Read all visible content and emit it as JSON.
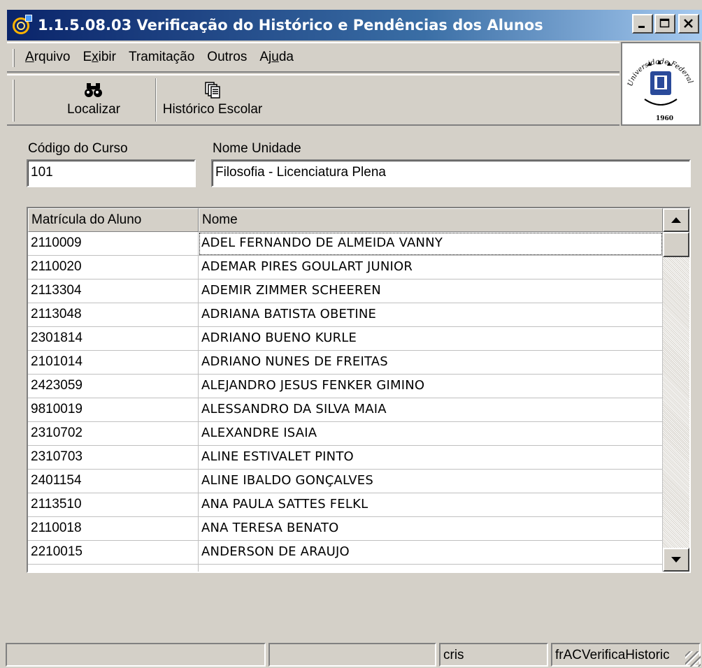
{
  "window": {
    "title": "1.1.5.08.03 Verificação do Histórico e Pendências dos Alunos",
    "minimize_label": "_",
    "maximize_label": "□",
    "close_label": "✕"
  },
  "menu": {
    "items": [
      {
        "id": "arquivo",
        "first": "A",
        "rest": "rquivo"
      },
      {
        "id": "exibir",
        "pre": "E",
        "u": "x",
        "post": "ibir"
      },
      {
        "id": "tramitacao",
        "label": "Tramitação"
      },
      {
        "id": "outros",
        "label": "Outros"
      },
      {
        "id": "ajuda",
        "pre": "Aj",
        "u": "u",
        "post": "da"
      }
    ]
  },
  "toolbar": {
    "localizar_label": "Localizar",
    "localizar_icon": "binoculars-icon",
    "historico_label": "Histórico Escolar",
    "historico_icon": "documents-icon"
  },
  "logo": {
    "text_top": "Universidade Federal de Santa Maria",
    "year": "1960"
  },
  "form": {
    "codigo_label": "Código do Curso",
    "codigo_value": "101",
    "nome_label": "Nome Unidade",
    "nome_value": "Filosofia - Licenciatura Plena"
  },
  "grid": {
    "columns": [
      "Matrícula do Aluno",
      "Nome"
    ],
    "rows": [
      [
        "2110009",
        "ADEL FERNANDO DE ALMEIDA VANNY"
      ],
      [
        "2110020",
        "ADEMAR PIRES GOULART JUNIOR"
      ],
      [
        "2113304",
        "ADEMIR ZIMMER SCHEEREN"
      ],
      [
        "2113048",
        "ADRIANA BATISTA OBETINE"
      ],
      [
        "2301814",
        "ADRIANO BUENO KURLE"
      ],
      [
        "2101014",
        "ADRIANO NUNES DE FREITAS"
      ],
      [
        "2423059",
        "ALEJANDRO JESUS FENKER GIMINO"
      ],
      [
        "9810019",
        "ALESSANDRO DA SILVA MAIA"
      ],
      [
        "2310702",
        "ALEXANDRE ISAIA"
      ],
      [
        "2310703",
        "ALINE ESTIVALET PINTO"
      ],
      [
        "2401154",
        "ALINE IBALDO GONÇALVES"
      ],
      [
        "2113510",
        "ANA PAULA SATTES FELKL"
      ],
      [
        "2110018",
        "ANA TERESA BENATO"
      ],
      [
        "2210015",
        "ANDERSON DE ARAUJO"
      ]
    ],
    "focused_row": 0
  },
  "statusbar": {
    "panel1": "",
    "panel2": "",
    "user": "cris",
    "form_name": "frACVerificaHistoric"
  },
  "colors": {
    "titlebar_start": "#0a246a",
    "titlebar_end": "#a6caf0",
    "face": "#d4d0c8"
  }
}
